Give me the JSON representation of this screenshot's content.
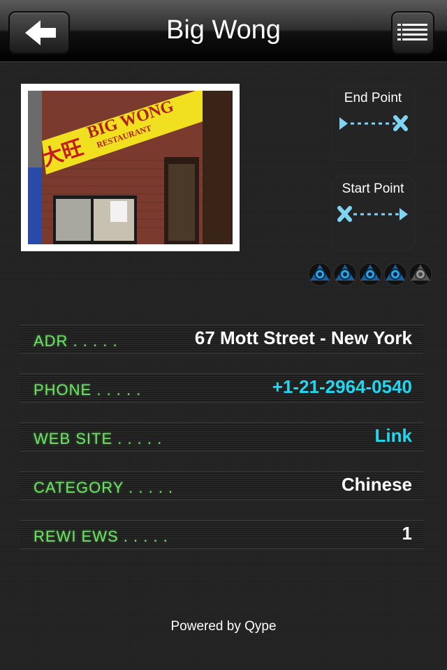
{
  "nav": {
    "title": "Big Wong"
  },
  "photo": {
    "sign_text": "BIG WONG",
    "sign_subtext": "RESTAURANT",
    "sign_chinese": "大旺"
  },
  "directions": {
    "end_label": "End Point",
    "start_label": "Start Point"
  },
  "rating": {
    "value": 4,
    "max": 5
  },
  "details": [
    {
      "label": "ADR . . . . .",
      "value": "67 Mott Street -  New York",
      "value_color": "#ffffff"
    },
    {
      "label": "PHONE . . . . .",
      "value": "+1-21-2964-0540",
      "value_color": "#1fd8f0"
    },
    {
      "label": "WEB SITE . . . . .",
      "value": "Link",
      "value_color": "#1fd8f0"
    },
    {
      "label": "CATEGORY . . . . .",
      "value": "Chinese",
      "value_color": "#ffffff"
    },
    {
      "label": "REWI EWS . . . . .",
      "value": "1",
      "value_color": "#ffffff"
    }
  ],
  "footer": {
    "text": "Powered by Qype"
  },
  "icons": {
    "back": "back-arrow-icon",
    "menu": "list-menu-icon",
    "end": "end-point-route-icon",
    "start": "start-point-route-icon",
    "rating": "rating-dot-icon"
  }
}
